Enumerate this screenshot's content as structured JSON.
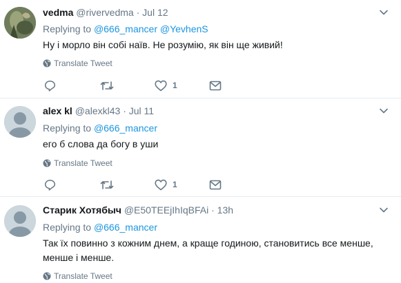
{
  "tweets": [
    {
      "name": "vedma",
      "handle": "@rivervedma",
      "separator": "·",
      "time": "Jul 12",
      "replying_prefix": "Replying to",
      "mentions": [
        "@666_mancer",
        "@YevhenS"
      ],
      "text": "Ну і морло він собі наїв. Не розумію, як він ще живий!",
      "translate_label": "Translate Tweet",
      "like_count": "1",
      "avatar": "photo"
    },
    {
      "name": "alex kl",
      "handle": "@alexkl43",
      "separator": "·",
      "time": "Jul 11",
      "replying_prefix": "Replying to",
      "mentions": [
        "@666_mancer"
      ],
      "text": "его б слова да богу в уши",
      "translate_label": "Translate Tweet",
      "like_count": "1",
      "avatar": "default"
    },
    {
      "name": "Старик Хотябыч",
      "handle": "@E50TEEjIhIqBFAi",
      "separator": "·",
      "time": "13h",
      "replying_prefix": "Replying to",
      "mentions": [
        "@666_mancer"
      ],
      "text": "Так їх повинно з кожним днем, а краще годиною, становитись все менше, менше і менше.",
      "translate_label": "Translate Tweet",
      "avatar": "default"
    }
  ],
  "colors": {
    "text": "#14171a",
    "secondary": "#657786",
    "link": "#1b95e0",
    "divider": "#e6ecf0",
    "avatar_default": "#ccd6dd"
  },
  "icons": {
    "reply": "reply-icon",
    "retweet": "retweet-icon",
    "like": "heart-icon",
    "dm": "envelope-icon",
    "translate": "globe-icon",
    "more": "chevron-down-icon"
  }
}
